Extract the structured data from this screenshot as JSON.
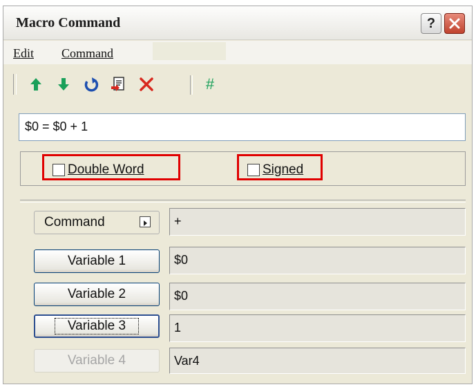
{
  "window": {
    "title": "Macro Command",
    "help_glyph": "?"
  },
  "menu": [
    {
      "label": "Edit"
    },
    {
      "label": "Command"
    }
  ],
  "toolbar": {
    "icons": [
      "move-up-icon",
      "move-down-icon",
      "undo-icon",
      "copy-doc-icon",
      "delete-icon",
      "hash-icon"
    ],
    "hash_glyph": "#"
  },
  "expression": "$0 = $0 + 1",
  "options": {
    "double_word": {
      "label": "Double Word",
      "checked": false
    },
    "signed": {
      "label": "Signed",
      "checked": false
    }
  },
  "rows": [
    {
      "button": "Command",
      "value": "+"
    },
    {
      "button": "Variable 1",
      "value": "$0"
    },
    {
      "button": "Variable 2",
      "value": "$0"
    },
    {
      "button": "Variable 3",
      "value": "1"
    },
    {
      "button": "Variable 4",
      "value": "Var4"
    }
  ],
  "colors": {
    "highlight": "#e00000",
    "arrow_green": "#1aa05a",
    "delete_red": "#d8281e"
  }
}
